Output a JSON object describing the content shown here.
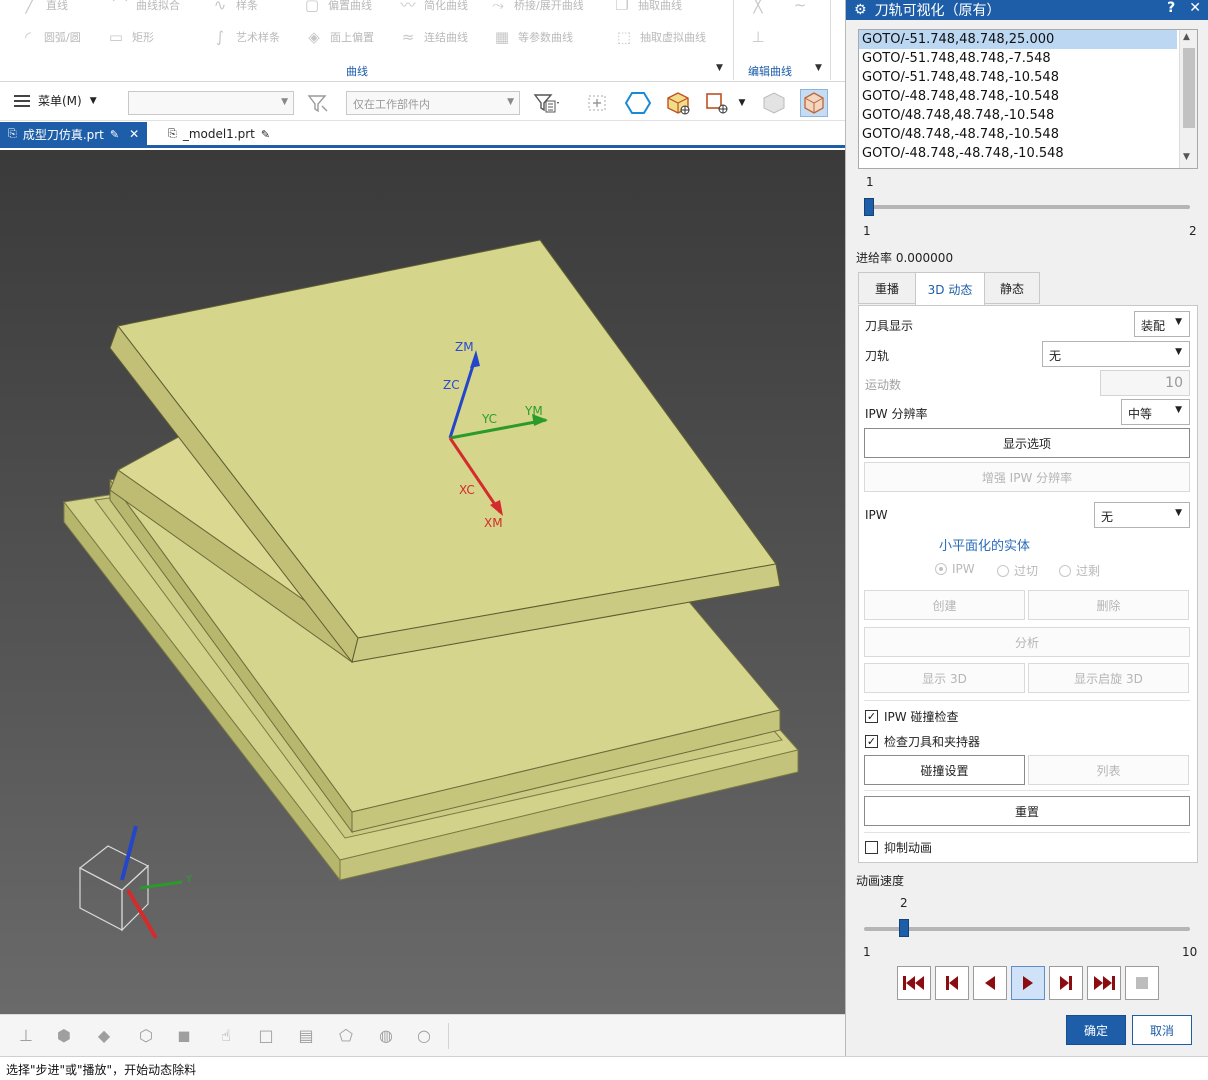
{
  "ribbon": {
    "row1": [
      "直线",
      "曲线拟合",
      "样条",
      "偏置曲线",
      "简化曲线",
      "桥接/展开曲线",
      "抽取曲线"
    ],
    "row2": [
      "圆弧/圆",
      "矩形",
      "艺术样条",
      "面上偏置",
      "连结曲线",
      "等参数曲线",
      "抽取虚拟曲线"
    ],
    "group_curve": "曲线",
    "group_edit_curve": "编辑曲线"
  },
  "toolbar": {
    "menu_label": "菜单(M)",
    "filter_placeholder": "",
    "scope_select": "仅在工作部件内"
  },
  "doc_tabs": [
    {
      "label": "成型刀仿真.prt",
      "active": true
    },
    {
      "label": "_model1.prt",
      "active": false
    }
  ],
  "viewport": {
    "csys_labels": {
      "zm": "ZM",
      "zc": "ZC",
      "yc": "YC",
      "ym": "YM",
      "xc": "XC",
      "xm": "XM"
    },
    "triad_label_y": "Y"
  },
  "status_text": "选择\"步进\"或\"播放\"，开始动态除料",
  "dialog": {
    "title": "刀轨可视化（原有）",
    "help": "?",
    "close": "✕",
    "goto_items": [
      "GOTO/-51.748,48.748,25.000",
      "GOTO/-51.748,48.748,-7.548",
      "GOTO/-51.748,48.748,-10.548",
      "GOTO/-48.748,48.748,-10.548",
      "GOTO/48.748,48.748,-10.548",
      "GOTO/48.748,-48.748,-10.548",
      "GOTO/-48.748,-48.748,-10.548"
    ],
    "selected_index": 0,
    "step_slider": {
      "value": "1",
      "min": "1",
      "max": "2",
      "fraction": 0
    },
    "feed_rate": "进给率 0.000000",
    "tabs": [
      "重播",
      "3D 动态",
      "静态"
    ],
    "active_tab": 1,
    "tool_display_label": "刀具显示",
    "tool_display_value": "装配",
    "toolpath_label": "刀轨",
    "toolpath_value": "无",
    "motion_count_label": "运动数",
    "motion_count_value": "10",
    "ipw_res_label": "IPW 分辨率",
    "ipw_res_value": "中等",
    "display_options_btn": "显示选项",
    "enhance_ipw_btn": "增强 IPW 分辨率",
    "ipw_label": "IPW",
    "ipw_value": "无",
    "facet_title": "小平面化的实体",
    "radio_ipw": "IPW",
    "radio_overcut": "过切",
    "radio_excess": "过剩",
    "create_btn": "创建",
    "delete_btn": "删除",
    "analyze_btn": "分析",
    "show3d_btn": "显示 3D",
    "show_rotate3d_btn": "显示启旋 3D",
    "ipw_collision_check": "IPW 碰撞检查",
    "check_tool_holder": "检查刀具和夹持器",
    "collision_settings_btn": "碰撞设置",
    "list_btn": "列表",
    "reset_btn": "重置",
    "suppress_anim": "抑制动画",
    "anim_speed_label": "动画速度",
    "speed_slider": {
      "value": "2",
      "min": "1",
      "max": "10",
      "fraction": 0.111
    },
    "ok_btn": "确定",
    "cancel_btn": "取消"
  },
  "colors": {
    "accent": "#1e5ea8",
    "model_top": "#d4d48a",
    "model_side": "#b9b86e",
    "vcr_red": "#8b0d12"
  }
}
